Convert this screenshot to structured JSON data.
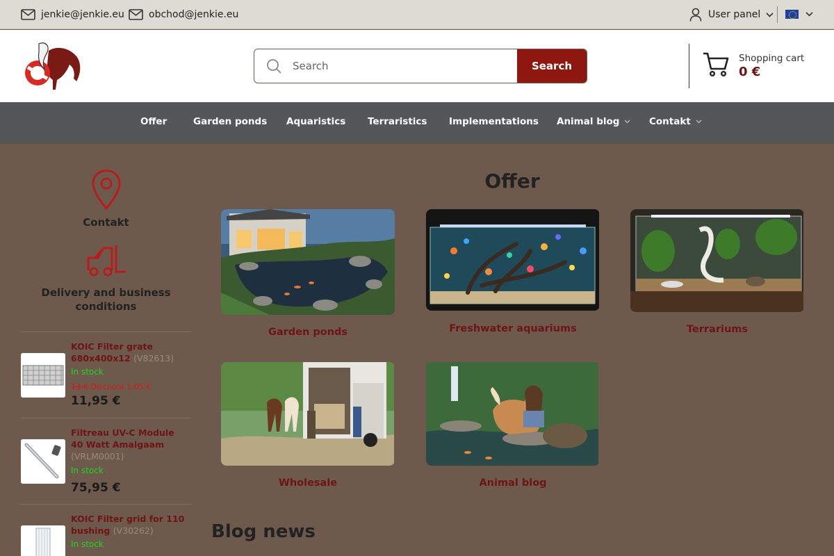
{
  "topbar": {
    "email1": "jenkie@jenkie.eu",
    "email2": "obchod@jenkie.eu",
    "user_panel": "User panel"
  },
  "header": {
    "search_placeholder": "Search",
    "search_button": "Search",
    "cart_label": "Shopping cart",
    "cart_total": "0 €"
  },
  "nav": {
    "items": [
      "Offer",
      "Garden ponds",
      "Aquaristics",
      "Terraristics",
      "Implementations",
      "Animal blog",
      "Contakt"
    ]
  },
  "sidebar": {
    "contact_label": "Contakt",
    "delivery_label": "Delivery and business conditions",
    "products": [
      {
        "name": "KOIC Filter grate 680x400x12",
        "code": "(V82613)",
        "stock": "In stock",
        "old_price": "13 €",
        "discount": "Discount 1,05 €",
        "price": "11,95 €"
      },
      {
        "name": "Filtreau UV-C Module 40 Watt Amalgaam",
        "code": "(VRLM0001)",
        "stock": "In stock",
        "price": "75,95 €"
      },
      {
        "name": "KOIC Filter grid for 110 bushing",
        "code": "(V30262)",
        "stock": "In stock"
      }
    ]
  },
  "main": {
    "offer_title": "Offer",
    "categories": [
      "Garden ponds",
      "Freshwater aquariums",
      "Terrariums",
      "Wholesale",
      "Animal blog"
    ],
    "blog_title": "Blog news"
  },
  "colors": {
    "background": "#6d5a4c",
    "accent": "#8e1710",
    "nav": "#555658",
    "in_stock": "#21d521"
  }
}
